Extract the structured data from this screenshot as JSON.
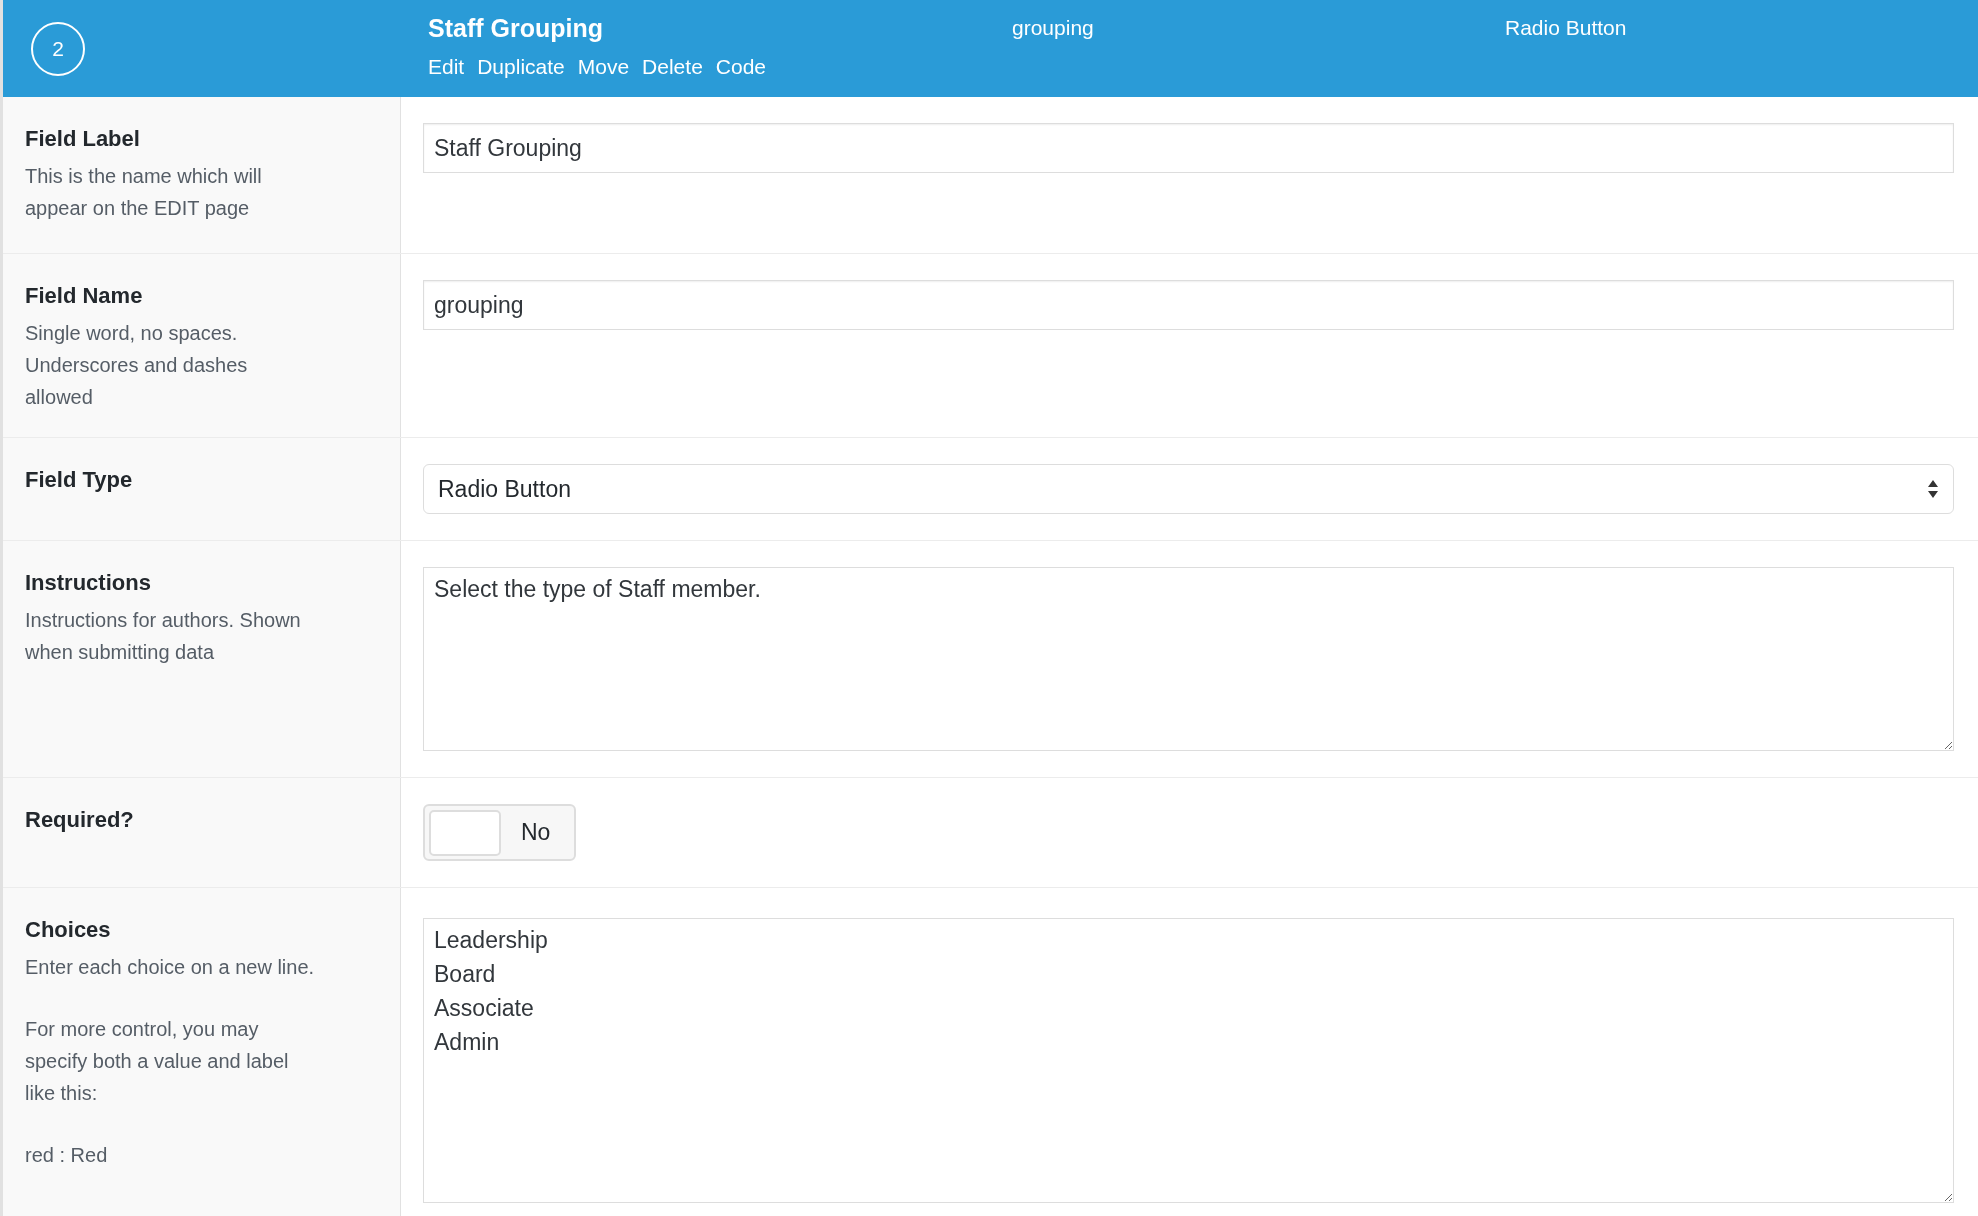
{
  "header": {
    "order": "2",
    "title": "Staff Grouping",
    "actions": [
      "Edit",
      "Duplicate",
      "Move",
      "Delete",
      "Code"
    ],
    "name": "grouping",
    "type": "Radio Button"
  },
  "rows": [
    {
      "kind": "text",
      "label": "Field Label",
      "description": [
        "This is the name which will appear on the EDIT page"
      ],
      "value": "Staff Grouping"
    },
    {
      "kind": "text",
      "label": "Field Name",
      "description": [
        "Single word, no spaces. Underscores and dashes allowed"
      ],
      "value": "grouping"
    },
    {
      "kind": "select",
      "label": "Field Type",
      "value": "Radio Button"
    },
    {
      "kind": "textarea",
      "label": "Instructions",
      "description": [
        "Instructions for authors. Shown when submitting data"
      ],
      "lines": [
        "Select the type of Staff member."
      ]
    },
    {
      "kind": "toggle",
      "label": "Required?",
      "on": false,
      "state_text": "No"
    },
    {
      "kind": "textarea",
      "label": "Choices",
      "description": [
        "Enter each choice on a new line.",
        "For more control, you may specify both a value and label like this:",
        "red : Red"
      ],
      "lines": [
        "Leadership",
        "Board",
        "Associate",
        "Admin"
      ]
    }
  ]
}
